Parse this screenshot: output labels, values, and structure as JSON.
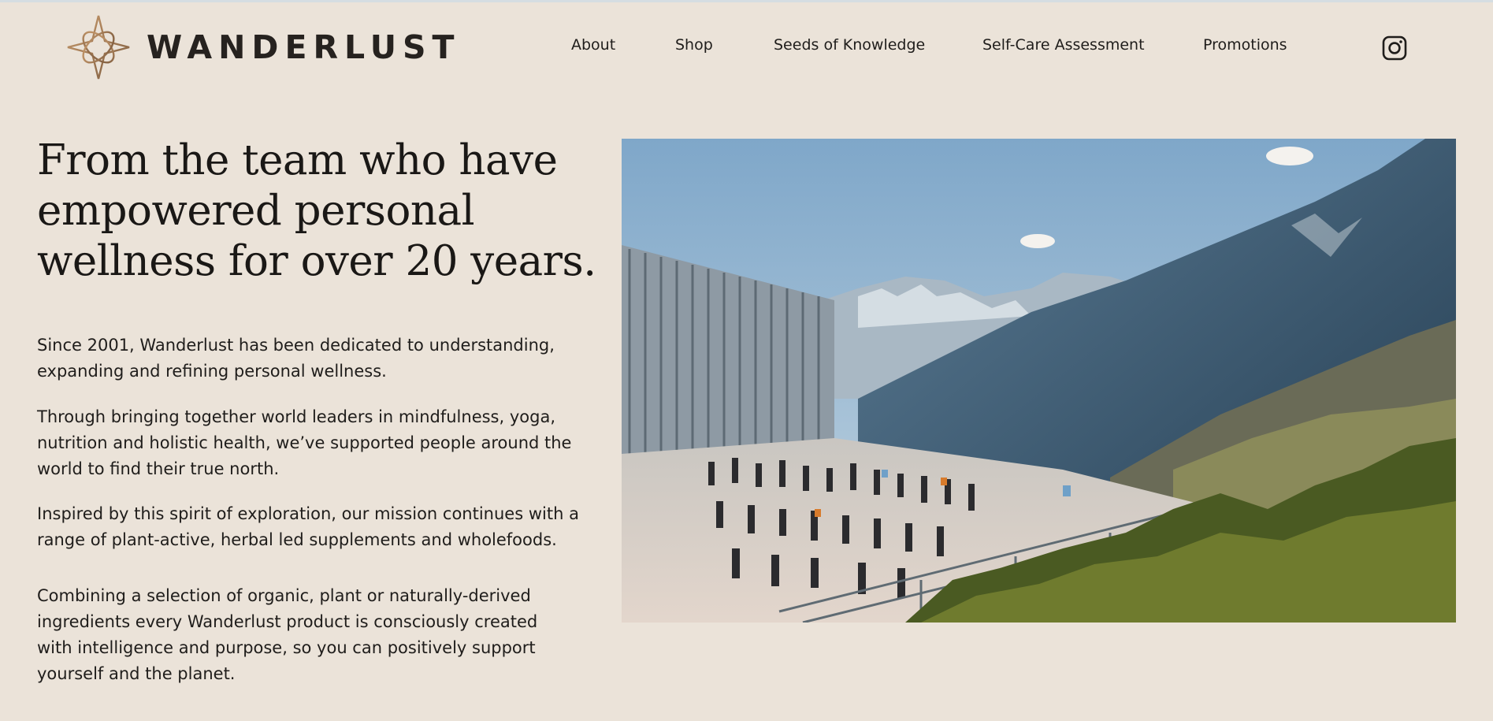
{
  "brand": {
    "name": "WANDERLUST"
  },
  "nav": {
    "items": [
      {
        "label": "About"
      },
      {
        "label": "Shop"
      },
      {
        "label": "Seeds of Knowledge"
      },
      {
        "label": "Self-Care Assessment"
      },
      {
        "label": "Promotions"
      }
    ],
    "social_icon": "instagram-icon"
  },
  "hero": {
    "headline_lines": [
      "From the team who have",
      "empowered personal",
      "wellness for over 20 years."
    ],
    "paragraphs": [
      [
        "Since 2001, Wanderlust has been dedicated to understanding,",
        "expanding and refining personal wellness."
      ],
      [
        "Through bringing together world leaders in mindfulness, yoga,",
        "nutrition and holistic health, we’ve supported people around the",
        "world to find their true north."
      ],
      [
        "Inspired by this spirit of exploration, our mission continues with a",
        "range of plant-active, herbal led supplements and wholefoods."
      ],
      [
        "Combining a selection of organic, plant or naturally-derived",
        "ingredients every Wanderlust product is consciously created",
        "with intelligence and purpose, so you can positively support",
        "yourself and the planet."
      ]
    ],
    "image_subject": "outdoor-yoga-class-mountains-photo"
  },
  "colors": {
    "background": "#ebe3d9",
    "text": "#1f1d1b",
    "logo_gold": "#a07a52"
  }
}
